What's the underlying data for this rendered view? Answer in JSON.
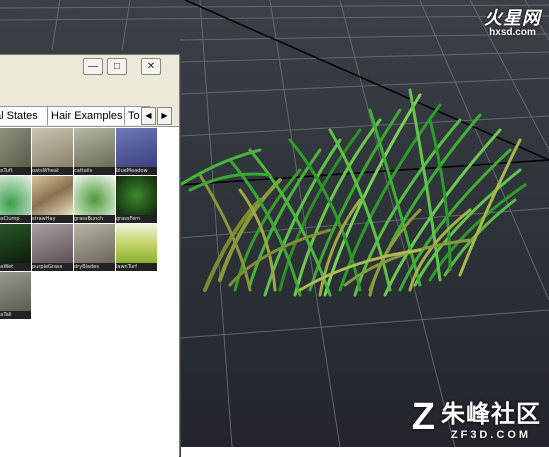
{
  "watermark_top": {
    "logo": "火星网",
    "site": "hxsd.com"
  },
  "watermark_bottom": {
    "mark": "Z",
    "name": "朱峰社区",
    "url": "ZF3D.COM"
  },
  "window": {
    "buttons": {
      "minimize": "—",
      "maximize": "□",
      "close": "✕"
    },
    "tabs": [
      {
        "label": "al States"
      },
      {
        "label": "Hair Examples"
      },
      {
        "label": "To"
      }
    ],
    "scroll_left": "◀",
    "scroll_right": "▶",
    "thumbnails": [
      {
        "label": "grassTuft",
        "icon": "grass-photo-icon"
      },
      {
        "label": "oatsWheat",
        "icon": "wheat-photo-icon"
      },
      {
        "label": "cattails",
        "icon": "cattail-photo-icon"
      },
      {
        "label": "blueMeadow",
        "icon": "blue-grass-icon"
      },
      {
        "label": "grassClump",
        "icon": "green-grass-icon"
      },
      {
        "label": "strawHay",
        "icon": "straw-icon"
      },
      {
        "label": "grassBunch",
        "icon": "grass-bunch-icon"
      },
      {
        "label": "grassFern",
        "icon": "fern-grass-icon"
      },
      {
        "label": "grassWet",
        "icon": "dark-grass-icon"
      },
      {
        "label": "purpleGrass",
        "icon": "purple-grass-icon"
      },
      {
        "label": "dryBlades",
        "icon": "dry-blades-icon"
      },
      {
        "label": "lawnTurf",
        "icon": "lawn-icon"
      },
      {
        "label": "grassTall",
        "icon": "tall-grass-icon"
      }
    ]
  }
}
